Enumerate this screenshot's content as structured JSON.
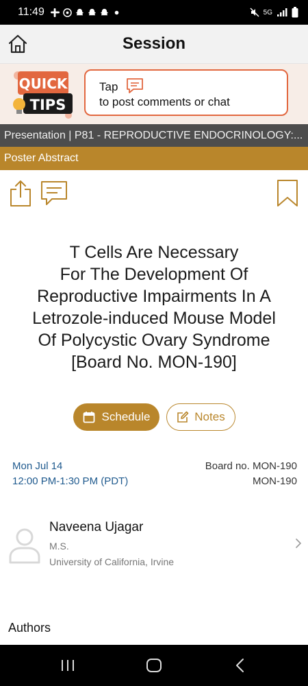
{
  "status_bar": {
    "time": "11:49",
    "left_icons": [
      "slack-icon",
      "whatsapp-icon",
      "snapchat-icon",
      "snapchat-icon",
      "snapchat-icon",
      "dot-icon"
    ],
    "right_icons": [
      "mute-icon",
      "5g-icon",
      "signal-icon",
      "battery-icon"
    ],
    "network": "5G"
  },
  "header": {
    "title": "Session",
    "home_icon": "home-icon"
  },
  "quick_tips": {
    "logo_line1": "QUICK",
    "logo_line2": "TIPS",
    "tap_label": "Tap",
    "instruction": "to post comments or chat"
  },
  "presentation_bar": {
    "text": "Presentation | P81 - REPRODUCTIVE ENDOCRINOLOGY:..."
  },
  "poster_bar": {
    "text": "Poster Abstract"
  },
  "session": {
    "title_lines": [
      "T Cells Are Necessary",
      "For The Development Of",
      "Reproductive Impairments In A",
      "Letrozole-induced Mouse Model",
      "Of Polycystic Ovary Syndrome",
      "[Board No. MON-190]"
    ],
    "date": "Mon Jul 14",
    "time_range": "12:00 PM-1:30 PM (PDT)",
    "board_label": "Board no. MON-190",
    "board_code": "MON-190"
  },
  "actions": {
    "schedule_label": "Schedule",
    "notes_label": "Notes"
  },
  "speaker": {
    "name": "Naveena Ujagar",
    "degree": "M.S.",
    "institution": "University of California, Irvine"
  },
  "authors_heading": "Authors",
  "colors": {
    "accent": "#b9862b",
    "date_blue": "#1f5a8e",
    "tips_border": "#e2673f",
    "presentation_bar": "#4d4d4d"
  }
}
